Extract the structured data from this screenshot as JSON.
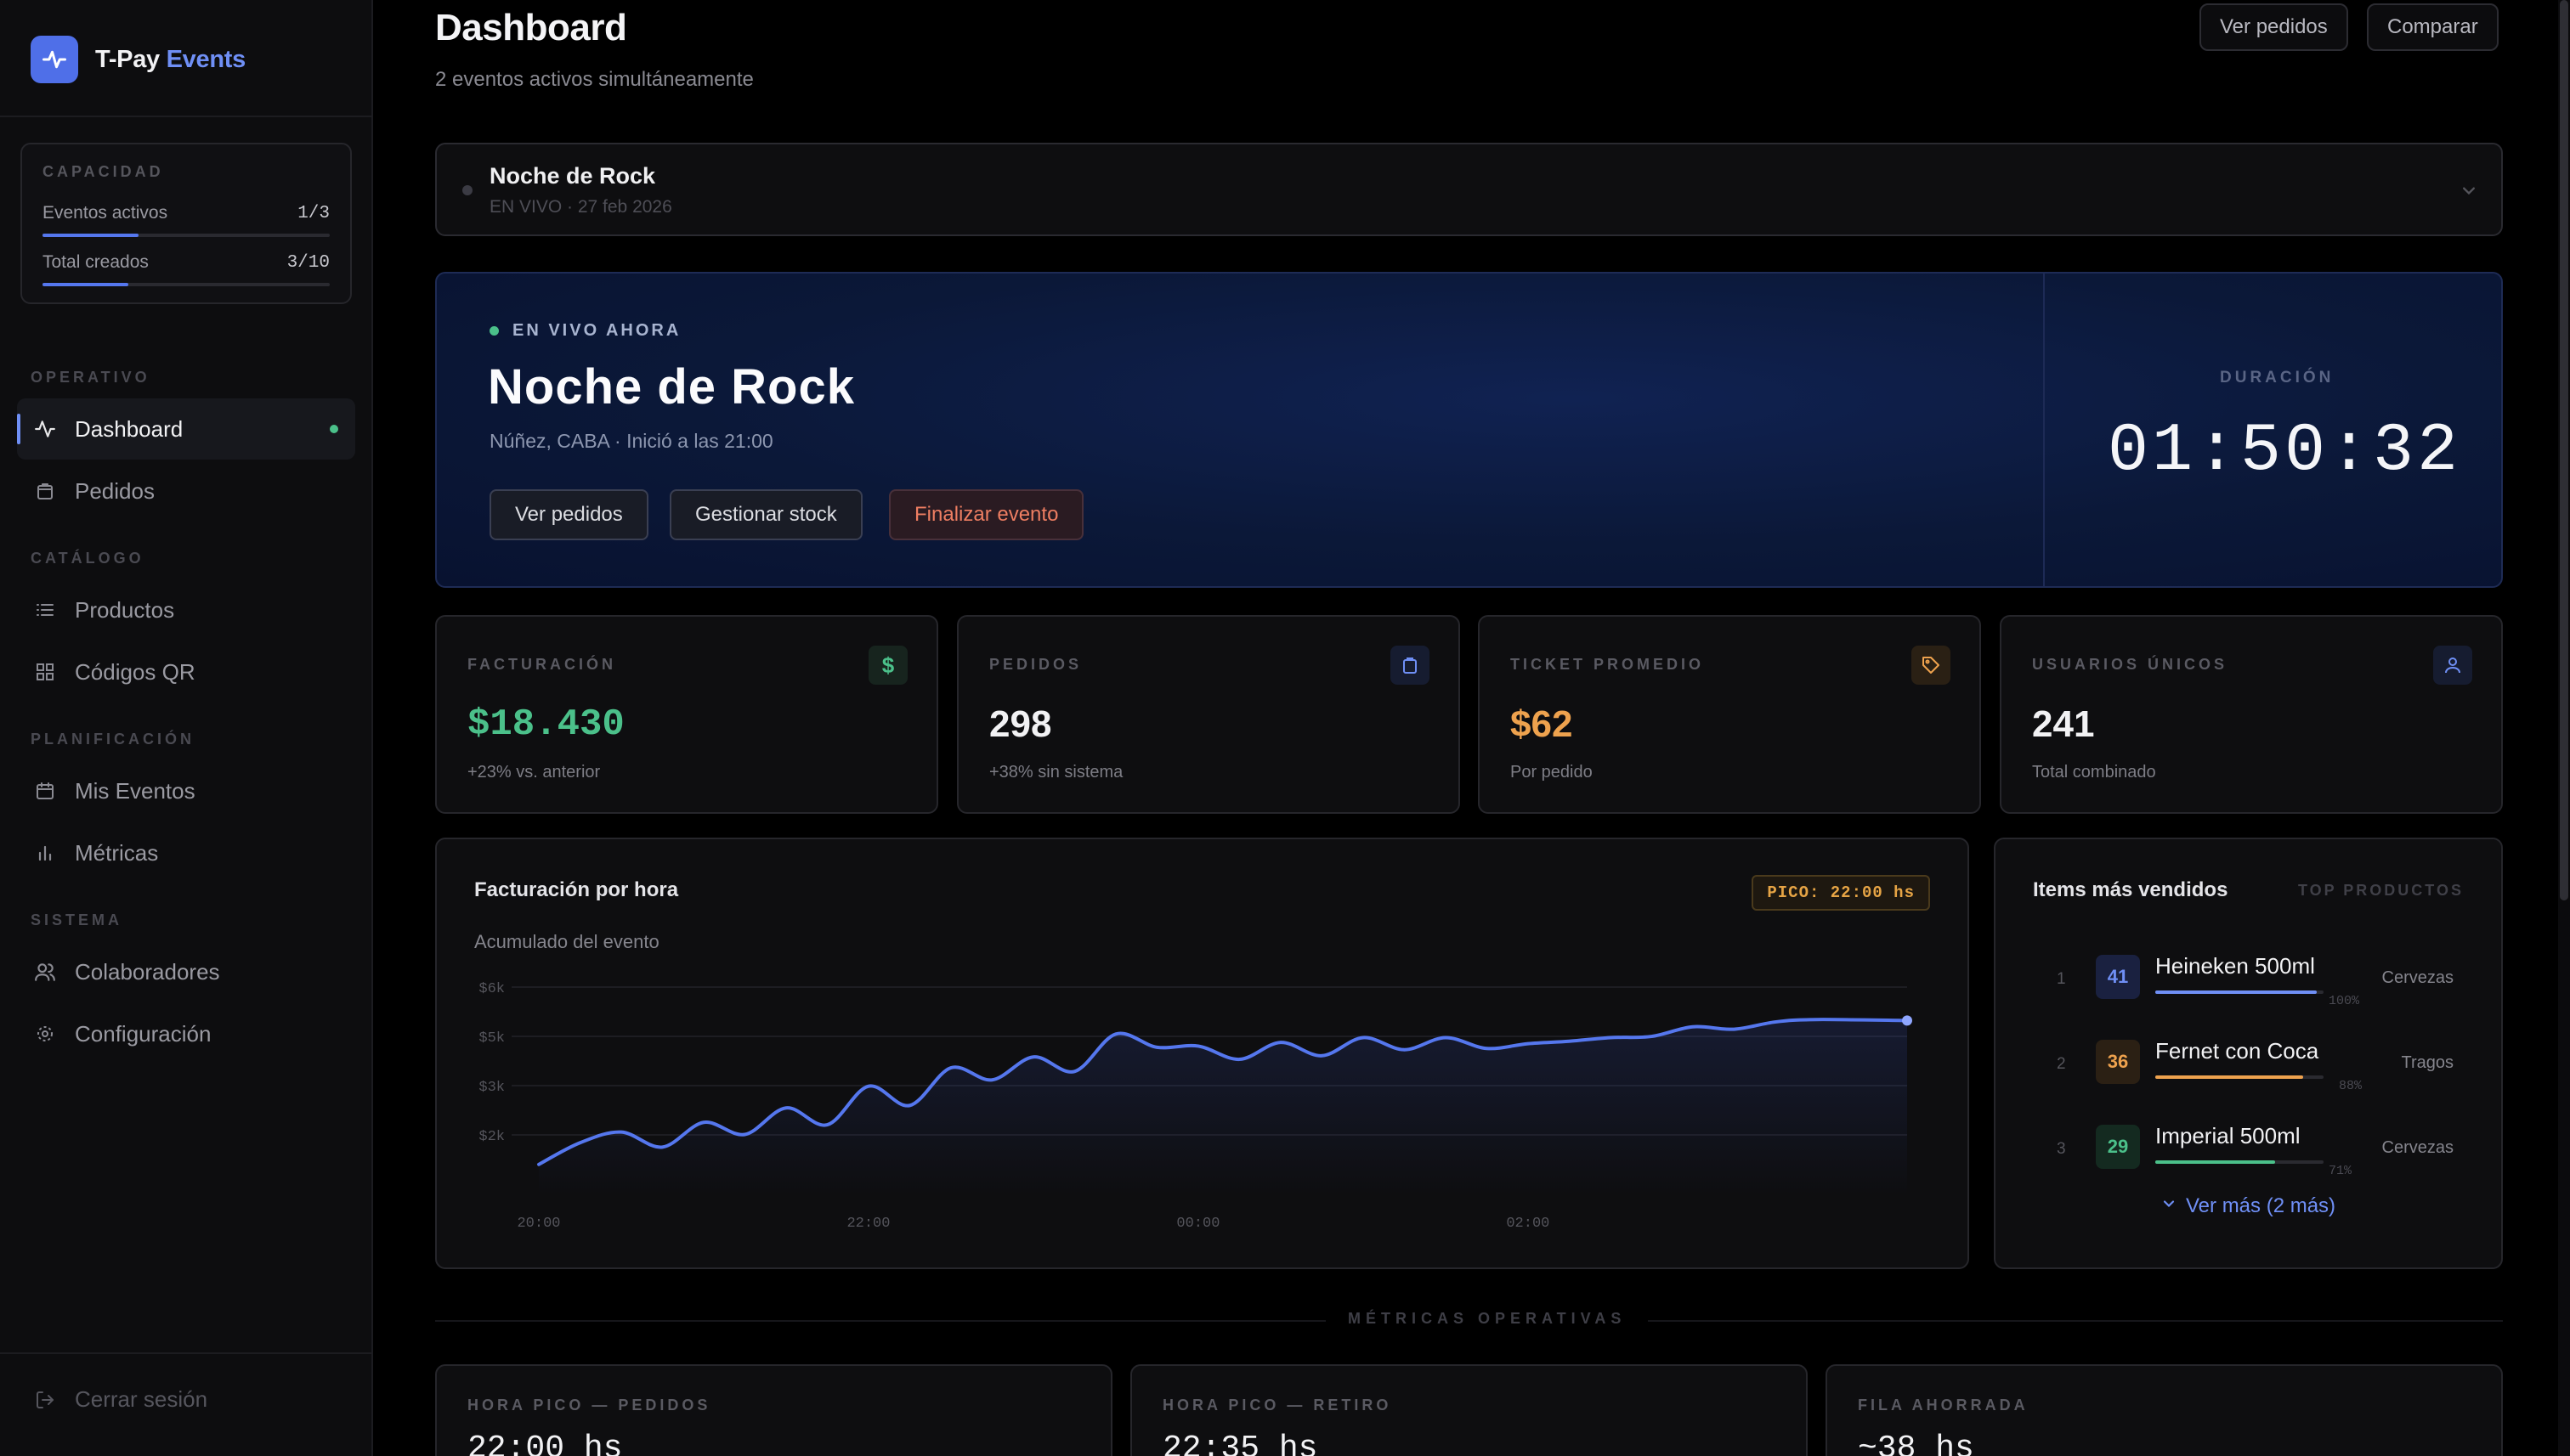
{
  "brand": {
    "name": "T-Pay",
    "accent": "Events",
    "logo_icon": "pulse-icon"
  },
  "capacity": {
    "title": "CAPACIDAD",
    "rows": [
      {
        "label": "Eventos activos",
        "value": "1/3",
        "fraction": 0.333
      },
      {
        "label": "Total creados",
        "value": "3/10",
        "fraction": 0.3
      }
    ]
  },
  "nav": {
    "sections": {
      "operativo": "OPERATIVO",
      "catalogo": "CATÁLOGO",
      "planificacion": "PLANIFICACIÓN",
      "sistema": "SISTEMA"
    },
    "items": [
      {
        "label": "Dashboard",
        "icon": "activity-icon",
        "active": true
      },
      {
        "label": "Pedidos",
        "icon": "bag-icon"
      },
      {
        "label": "Productos",
        "icon": "list-icon"
      },
      {
        "label": "Códigos QR",
        "icon": "grid-icon"
      },
      {
        "label": "Mis Eventos",
        "icon": "calendar-icon"
      },
      {
        "label": "Métricas",
        "icon": "bar-chart-icon"
      },
      {
        "label": "Colaboradores",
        "icon": "users-icon"
      },
      {
        "label": "Configuración",
        "icon": "gear-icon"
      }
    ],
    "logout": "Cerrar sesión"
  },
  "header": {
    "title": "Dashboard",
    "subtitle": "2 eventos activos simultáneamente",
    "buttons": {
      "orders": "Ver pedidos",
      "compare": "Comparar"
    }
  },
  "selector": {
    "title": "Noche de Rock",
    "subtitle": "EN VIVO · 27 feb 2026"
  },
  "hero": {
    "live_label": "EN VIVO AHORA",
    "title": "Noche de Rock",
    "location": "Núñez, CABA · Inició a las 21:00",
    "buttons": {
      "orders": "Ver pedidos",
      "stock": "Gestionar stock",
      "end": "Finalizar evento"
    },
    "duration_label": "DURACIÓN",
    "duration": "01:50:32"
  },
  "stats": [
    {
      "label": "FACTURACIÓN",
      "value": "$18.430",
      "sub": "+23% vs. anterior",
      "icon": "dollar-icon",
      "color": "#4bc08a"
    },
    {
      "label": "PEDIDOS",
      "value": "298",
      "sub": "+38% sin sistema",
      "icon": "bag-icon",
      "color": "#f2f2f4"
    },
    {
      "label": "TICKET PROMEDIO",
      "value": "$62",
      "sub": "Por pedido",
      "icon": "tag-icon",
      "color": "#eea24e"
    },
    {
      "label": "USUARIOS ÚNICOS",
      "value": "241",
      "sub": "Total combinado",
      "icon": "user-icon",
      "color": "#f2f2f4"
    }
  ],
  "chart": {
    "title": "Facturación por hora",
    "subtitle": "Acumulado del evento",
    "peak": "PICO: 22:00 hs"
  },
  "chart_data": {
    "type": "line",
    "title": "Facturación por hora",
    "xlabel": "",
    "ylabel": "",
    "x_ticks": [
      "20:00",
      "22:00",
      "00:00",
      "02:00"
    ],
    "y_ticks": [
      "$2k",
      "$3k",
      "$5k",
      "$6k"
    ],
    "ylim": [
      1500,
      6200
    ],
    "grid": true,
    "series": [
      {
        "color": "#5577ee",
        "x": [
          0,
          0.25,
          0.5,
          0.75,
          1,
          1.25,
          1.5,
          1.75,
          2,
          2.25,
          2.5,
          2.75,
          3,
          3.25,
          3.5,
          3.75,
          4,
          4.25,
          4.5,
          4.75,
          5,
          5.25,
          5.5,
          5.75,
          6,
          6.25,
          6.5,
          6.75,
          7,
          7.25,
          7.5,
          7.75,
          8.3
        ],
        "y": [
          1700,
          1950,
          2100,
          1900,
          2300,
          2050,
          2600,
          2250,
          3050,
          2650,
          3800,
          3300,
          4250,
          3650,
          5150,
          4650,
          4700,
          4150,
          4850,
          4300,
          5050,
          4550,
          5050,
          4600,
          4800,
          4900,
          5050,
          5100,
          5300,
          5250,
          5400,
          5450,
          5430
        ]
      }
    ]
  },
  "top_products": {
    "title": "Items más vendidos",
    "tag": "TOP PRODUCTOS",
    "items": [
      {
        "rank": "1",
        "qty": "41",
        "name": "Heineken 500ml",
        "pct": "100%",
        "fraction": 1.0,
        "category": "Cervezas",
        "color": "#6f8ff5",
        "bg": "#1a2140"
      },
      {
        "rank": "2",
        "qty": "36",
        "name": "Fernet con Coca",
        "pct": "88%",
        "fraction": 0.88,
        "category": "Tragos",
        "color": "#eea24e",
        "bg": "#2b2014"
      },
      {
        "rank": "3",
        "qty": "29",
        "name": "Imperial 500ml",
        "pct": "71%",
        "fraction": 0.71,
        "category": "Cervezas",
        "color": "#4bc08a",
        "bg": "#142a20"
      }
    ],
    "more": "Ver más (2 más)"
  },
  "operational": {
    "section": "MÉTRICAS OPERATIVAS",
    "cards": [
      {
        "label": "HORA PICO — PEDIDOS",
        "value": "22:00 hs"
      },
      {
        "label": "HORA PICO — RETIRO",
        "value": "22:35 hs"
      },
      {
        "label": "FILA AHORRADA",
        "value": "~38 hs"
      }
    ]
  }
}
